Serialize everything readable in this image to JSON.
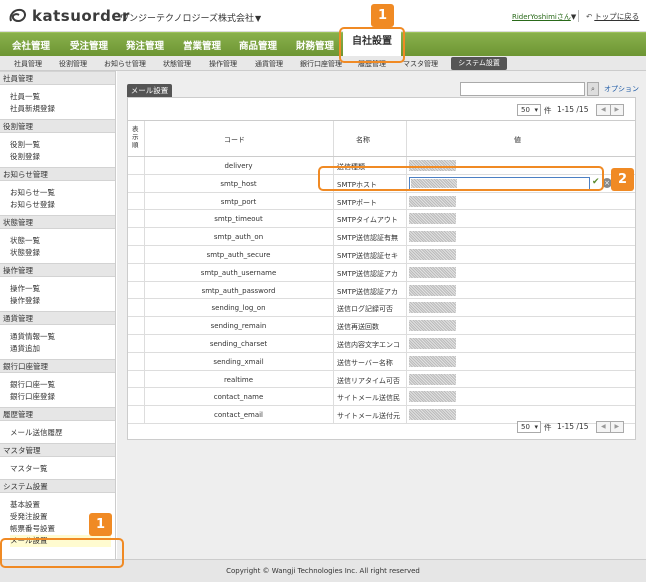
{
  "header": {
    "logo_text": "katsuorder",
    "company": "ワンジーテクノロジーズ株式会社",
    "company_caret": "▼",
    "user": "RiderYoshimiさん",
    "user_caret": "▼",
    "back_label": "トップに戻る"
  },
  "nav": {
    "items": [
      "会社管理",
      "受注管理",
      "発注管理",
      "営業管理",
      "商品管理",
      "財務管理"
    ],
    "active": "自社設置"
  },
  "subnav": {
    "items": [
      "社員管理",
      "役割管理",
      "お知らせ管理",
      "状態管理",
      "操作管理",
      "通貨管理",
      "銀行口座管理",
      "履歴管理",
      "マスタ管理"
    ],
    "active": "システム設置"
  },
  "sidebar": [
    {
      "title": "社員管理",
      "items": [
        "社員一覧",
        "社員新規登録"
      ]
    },
    {
      "title": "役割管理",
      "items": [
        "役割一覧",
        "役割登録"
      ]
    },
    {
      "title": "お知らせ管理",
      "items": [
        "お知らせ一覧",
        "お知らせ登録"
      ]
    },
    {
      "title": "状態管理",
      "items": [
        "状態一覧",
        "状態登録"
      ]
    },
    {
      "title": "操作管理",
      "items": [
        "操作一覧",
        "操作登録"
      ]
    },
    {
      "title": "通貨管理",
      "items": [
        "通貨情報一覧",
        "通貨追加"
      ]
    },
    {
      "title": "銀行口座管理",
      "items": [
        "銀行口座一覧",
        "銀行口座登録"
      ]
    },
    {
      "title": "履歴管理",
      "items": [
        "メール送信履歴"
      ]
    },
    {
      "title": "マスタ管理",
      "items": [
        "マスター覧"
      ]
    },
    {
      "title": "システム設置",
      "items": [
        "基本設置",
        "受発注設置",
        "帳票番号設置",
        "メール設置"
      ]
    }
  ],
  "panel": {
    "tab": "メール設置",
    "options_label": "オプション",
    "search_icon": "search-icon",
    "per_page": "50",
    "per_page_label": "件",
    "range": "1-15 /15",
    "columns": {
      "display": "表示順",
      "code": "コード",
      "name": "名称",
      "value": "値"
    },
    "rows": [
      {
        "code": "delivery",
        "name": "送信種類"
      },
      {
        "code": "smtp_host",
        "name": "SMTPホスト"
      },
      {
        "code": "smtp_port",
        "name": "SMTPポート"
      },
      {
        "code": "smtp_timeout",
        "name": "SMTPタイムアウト"
      },
      {
        "code": "smtp_auth_on",
        "name": "SMTP送信認証有無"
      },
      {
        "code": "smtp_auth_secure",
        "name": "SMTP送信認証セキ"
      },
      {
        "code": "smtp_auth_username",
        "name": "SMTP送信認証アカ"
      },
      {
        "code": "smtp_auth_password",
        "name": "SMTP送信認証アカ"
      },
      {
        "code": "sending_log_on",
        "name": "送信ログ記録可否"
      },
      {
        "code": "sending_remain",
        "name": "送信再送回数"
      },
      {
        "code": "sending_charset",
        "name": "送信内容文字エンコ"
      },
      {
        "code": "sending_xmail",
        "name": "送信サーバー名称"
      },
      {
        "code": "realtime",
        "name": "送信リアタイム可否"
      },
      {
        "code": "contact_name",
        "name": "サイトメール送信民"
      },
      {
        "code": "contact_email",
        "name": "サイトメール送付元"
      }
    ],
    "editing_row": 1,
    "confirm_symbol": "✔",
    "cancel_symbol": "×"
  },
  "footer": "Copyright © Wangji Technologies Inc. All right reserved",
  "callouts": [
    "1",
    "2",
    "1"
  ],
  "accent_color": "#f08a24",
  "nav_color": "#7aa33e"
}
